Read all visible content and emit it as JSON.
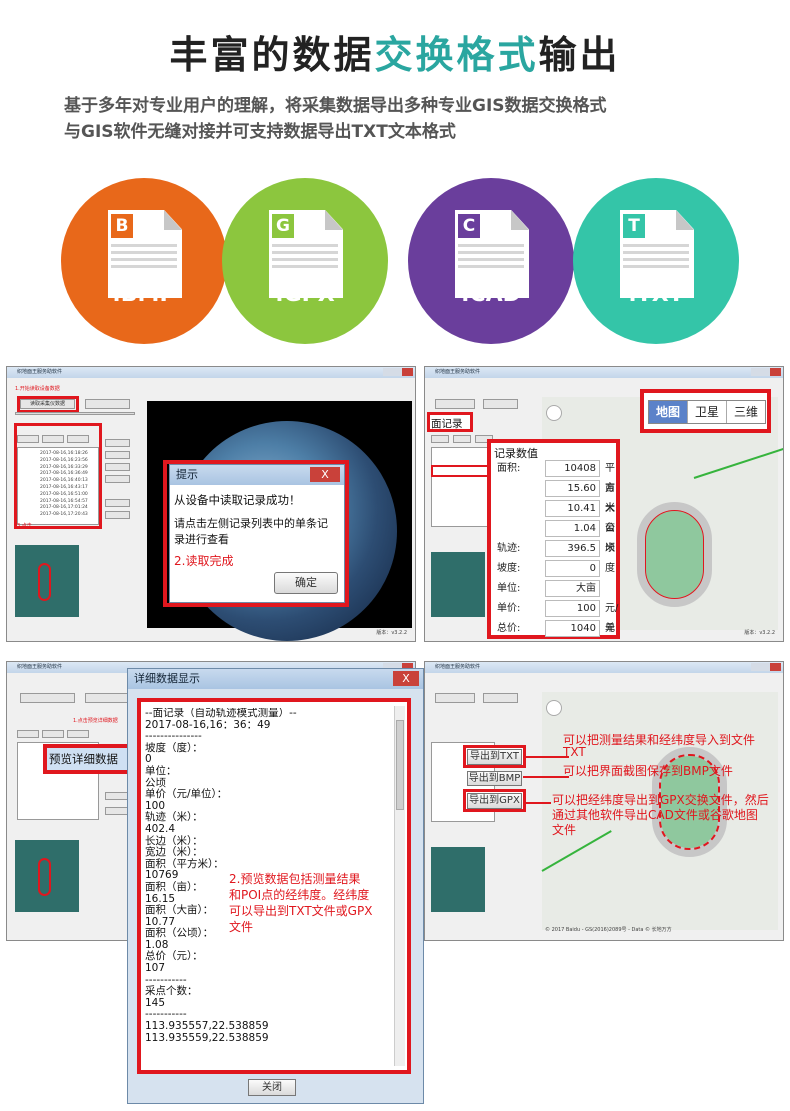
{
  "header": {
    "title_pre": "丰富的数据",
    "title_hl": "交换格式",
    "title_post": "输出",
    "line1": "基于多年对专业用户的理解，将采集数据导出多种专业GIS数据交换格式",
    "line2": "与GIS软件无缝对接并可支持数据导出TXT文本格式"
  },
  "formats": [
    {
      "letter": "B",
      "ext": ".BMP",
      "color": "#e8681a"
    },
    {
      "letter": "G",
      "ext": ".GPX",
      "color": "#8cc63e"
    },
    {
      "letter": "C",
      "ext": ".CAD",
      "color": "#6a3e9c"
    },
    {
      "letter": "T",
      "ext": ".TXT",
      "color": "#34c5a8"
    }
  ],
  "shot1": {
    "window_title": "织地面王服务助软件",
    "step1": "1.开始读取设备数据",
    "read_btn": "读取采集仪数据",
    "step3": "3.点击",
    "list_rows": [
      "2017-08-16,16:18:26",
      "2017-08-16,16:23:56",
      "2017-08-16,16:33:29",
      "2017-08-16,16:36:49",
      "2017-08-16,16:40:13",
      "2017-08-16,16:43:17",
      "2017-08-16,16:51:00",
      "2017-08-16,16:54:57",
      "2017-08-16,17:01:24",
      "2017-08-16,17:20:43"
    ],
    "dialog_title": "提示",
    "dialog_close": "X",
    "dialog_msg1": "从设备中读取记录成功！",
    "dialog_msg2": "请点击左侧记录列表中的单条记",
    "dialog_msg3": "录进行查看",
    "dialog_step": "2.读取完成",
    "dialog_ok": "确定",
    "version": "版本：v3.2.2"
  },
  "shot2": {
    "window_title": "织地面王服务助软件",
    "tab_label": "面记录",
    "map_tabs": [
      "地图",
      "卫星",
      "三维"
    ],
    "panel_title": "记录数值",
    "rows": [
      {
        "label": "面积:",
        "value": "10408",
        "unit": "平方米"
      },
      {
        "label": "",
        "value": "15.60",
        "unit": "亩"
      },
      {
        "label": "",
        "value": "10.41",
        "unit": "大亩"
      },
      {
        "label": "",
        "value": "1.04",
        "unit": "公顷"
      },
      {
        "label": "轨迹:",
        "value": "396.5",
        "unit": "米"
      },
      {
        "label": "坡度:",
        "value": "0",
        "unit": "度"
      },
      {
        "label": "单位:",
        "value": "大亩",
        "unit": ""
      },
      {
        "label": "单价:",
        "value": "100",
        "unit": "元/单位"
      },
      {
        "label": "总价:",
        "value": "1040",
        "unit": "元"
      }
    ],
    "version": "版本：v3.2.2"
  },
  "shot3": {
    "window_title": "织地面王服务助软件",
    "step1": "1.点击预览详细数据",
    "preview_btn": "预览详细数据"
  },
  "detail_dialog": {
    "title": "详细数据显示",
    "close": "X",
    "lines": [
      "--面记录（自动轨迹模式测量）--",
      "2017-08-16,16：36：49",
      "---------------",
      "坡度（度）：",
      "0",
      "单位：",
      "公顷",
      "单价（元/单位）：",
      "100",
      "轨迹（米）：",
      "402.4",
      "长边（米）：",
      "宽边（米）：",
      "面积（平方米）：",
      "10769",
      "面积（亩）：",
      "16.15",
      "面积（大亩）：",
      "10.77",
      "面积（公顷）：",
      "1.08",
      "总价（元）：",
      "107",
      "-----------",
      "采点个数：",
      "145",
      "-----------",
      "113.935557,22.538859",
      "113.935559,22.538859"
    ],
    "step2_l1": "2.预览数据包括测量结果",
    "step2_l2": "和POI点的经纬度。经纬度",
    "step2_l3": "可以导出到TXT文件或GPX",
    "step2_l4": "文件",
    "close_btn": "关闭"
  },
  "shot4": {
    "window_title": "织地面王服务助软件",
    "export_txt": "导出到TXT",
    "export_bmp": "导出到BMP",
    "export_gpx": "导出到GPX",
    "note1_l1": "可以把测量结果和经纬度导入到文件",
    "note1_l2": "TXT",
    "note2": "可以把界面截图保存到BMP文件",
    "note3_l1": "可以把经纬度导出到GPX交换文件，然后",
    "note3_l2": "通过其他软件导出CAD文件或谷歌地图",
    "note3_l3": "文件",
    "copyright": "© 2017 Baidu - GS(2016)2089号 - Data © 长地万方"
  }
}
